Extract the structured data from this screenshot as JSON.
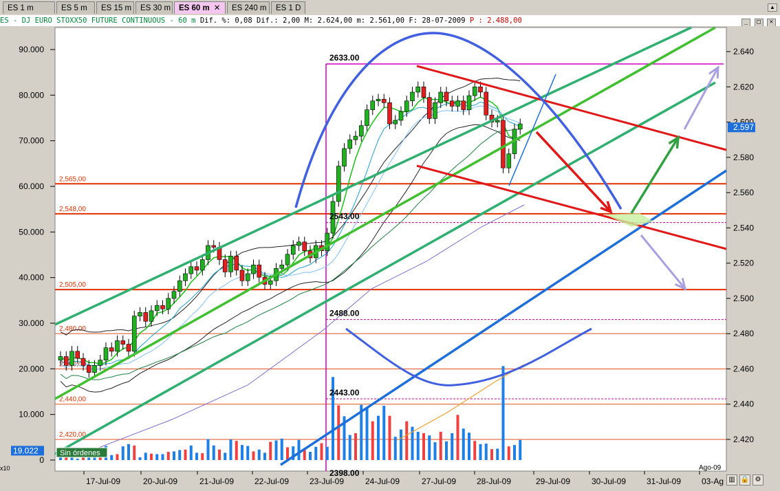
{
  "tabs": [
    {
      "label": "ES 1 m",
      "active": false
    },
    {
      "label": "ES 5 m",
      "active": false
    },
    {
      "label": "ES 15 m",
      "active": false
    },
    {
      "label": "ES 30 m",
      "active": false
    },
    {
      "label": "ES 60 m",
      "active": true
    },
    {
      "label": "ES 240 m",
      "active": false
    },
    {
      "label": "ES 1 D",
      "active": false
    }
  ],
  "tab_close": "✕",
  "info": {
    "name": "ES - DJ EURO STOXX50 FUTURE CONTINUOUS -  60 m",
    "dif_pct_label": "Dif. %:",
    "dif_pct": "0,08",
    "dif_label": "Dif.:",
    "dif": "2,00",
    "max_label": "M:",
    "max": "2.624,00",
    "min_label": "m:",
    "min": "2.561,00",
    "date_label": "F:",
    "date": "28-07-2009",
    "p_label": "P :",
    "p": "2.488,00"
  },
  "window_buttons": [
    "_",
    "□",
    "✕"
  ],
  "status": {
    "volume_current": "19.022",
    "orders": "Sin órdenes",
    "x10": "x10",
    "price_current": "2.597",
    "last_x_label": "Ago-09"
  },
  "icons": [
    "chart-type-icon",
    "lock-icon",
    "settings-icon"
  ],
  "chart_data": {
    "type": "candlestick",
    "left_axis": {
      "min": 0,
      "max": 90000,
      "ticks": [
        "0",
        "10.000",
        "20.000",
        "30.000",
        "40.000",
        "50.000",
        "60.000",
        "70.000",
        "80.000",
        "90.000"
      ]
    },
    "right_axis": {
      "min": 2400,
      "max": 2640,
      "ticks": [
        "2.420",
        "2.440",
        "2.460",
        "2.480",
        "2.500",
        "2.520",
        "2.540",
        "2.560",
        "2.580",
        "2.600",
        "2.620",
        "2.640"
      ]
    },
    "x_labels": [
      "17-Jul-09",
      "20-Jul-09",
      "21-Jul-09",
      "22-Jul-09",
      "23-Jul-09",
      "24-Jul-09",
      "27-Jul-09",
      "28-Jul-09",
      "29-Jul-09",
      "30-Jul-09",
      "31-Jul-09",
      "03-Ag"
    ],
    "levels": [
      {
        "label": "2,565,00",
        "value": 2565,
        "color": "#e03000"
      },
      {
        "label": "2,548,00",
        "value": 2548,
        "color": "#e03000"
      },
      {
        "label": "2,505,00",
        "value": 2505,
        "color": "#e03000"
      },
      {
        "label": "2,480,00",
        "value": 2480,
        "color": "#e05020"
      },
      {
        "label": "2,460,00",
        "value": 2460,
        "color": "#e05020"
      },
      {
        "label": "2,440,00",
        "value": 2440,
        "color": "#e05020"
      },
      {
        "label": "2,420,00",
        "value": 2420,
        "color": "#e05020"
      }
    ],
    "annotations": [
      {
        "label": "2633.00",
        "value": 2633
      },
      {
        "label": "2543.00",
        "value": 2543
      },
      {
        "label": "2488.00",
        "value": 2488
      },
      {
        "label": "2443.00",
        "value": 2443
      },
      {
        "label": "2398.00",
        "value": 2398
      }
    ],
    "close_prices": [
      2467,
      2462,
      2470,
      2466,
      2462,
      2458,
      2462,
      2465,
      2472,
      2470,
      2476,
      2474,
      2470,
      2490,
      2492,
      2487,
      2493,
      2496,
      2494,
      2500,
      2504,
      2510,
      2514,
      2518,
      2516,
      2522,
      2530,
      2529,
      2522,
      2515,
      2524,
      2516,
      2510,
      2514,
      2519,
      2512,
      2508,
      2510,
      2517,
      2519,
      2525,
      2530,
      2532,
      2527,
      2523,
      2530,
      2527,
      2537,
      2555,
      2575,
      2585,
      2590,
      2592,
      2598,
      2607,
      2612,
      2613,
      2611,
      2599,
      2601,
      2606,
      2612,
      2617,
      2620,
      2614,
      2602,
      2611,
      2617,
      2612,
      2609,
      2612,
      2607,
      2615,
      2620,
      2617,
      2604,
      2600,
      2601,
      2574,
      2582,
      2596,
      2599
    ],
    "volumes": [
      1.7,
      2.1,
      2.2,
      0.3,
      2.6,
      2.3,
      0.8,
      2.3,
      3.1,
      1.1,
      1.3,
      3.0,
      3.5,
      3.2,
      0.6,
      1.6,
      1.4,
      1.3,
      1.3,
      1.8,
      1.9,
      2.2,
      2.3,
      3.2,
      1.6,
      1.5,
      4.6,
      3.2,
      2.3,
      1.6,
      4.5,
      4.2,
      3.3,
      3.1,
      1.9,
      2.3,
      1.6,
      4.0,
      4.3,
      4.7,
      2.8,
      3.0,
      4.4,
      2.2,
      1.8,
      2.9,
      3.7,
      2.9,
      18.2,
      12.0,
      9.6,
      5.5,
      5.9,
      12.1,
      11.6,
      8.5,
      9.7,
      11.9,
      9.7,
      5.1,
      6.7,
      8.5,
      7.3,
      6.2,
      5.9,
      5.4,
      3.9,
      6.2,
      4.1,
      5.9,
      9.9,
      6.9,
      6.0,
      4.2,
      3.5,
      3.6,
      2.4,
      2.5,
      20.6,
      3.0,
      3.3,
      4.4
    ]
  }
}
